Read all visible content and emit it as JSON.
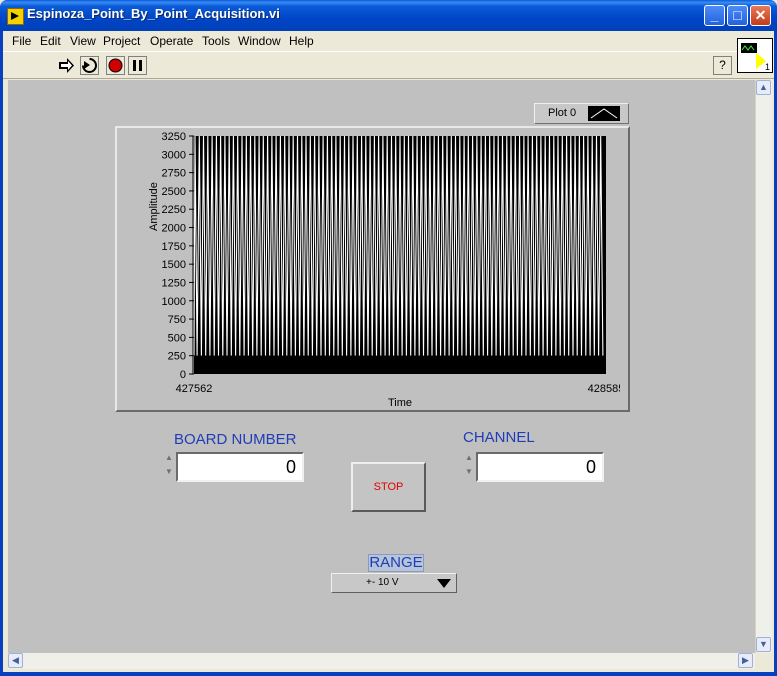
{
  "window": {
    "title": "Espinoza_Point_By_Point_Acquisition.vi"
  },
  "menu": [
    "File",
    "Edit",
    "View",
    "Project",
    "Operate",
    "Tools",
    "Window",
    "Help"
  ],
  "help_icon": "?",
  "vi_icon_number": "1",
  "graph": {
    "legend": "Plot 0",
    "ylabel": "Amplitude",
    "xlabel": "Time",
    "yticks": [
      "3250",
      "3000",
      "2750",
      "2500",
      "2250",
      "2000",
      "1750",
      "1500",
      "1250",
      "1000",
      "750",
      "500",
      "250",
      "0"
    ],
    "xstart": "427562",
    "xend": "428585"
  },
  "chart_data": {
    "type": "line",
    "title": "",
    "xlabel": "Time",
    "ylabel": "Amplitude",
    "xlim": [
      427562,
      428585
    ],
    "ylim": [
      0,
      3250
    ],
    "series": [
      {
        "name": "Plot 0",
        "x": [
          427562,
          428585
        ],
        "y_min": 250,
        "y_max": 3250
      }
    ],
    "grid": false,
    "legend": "top-right"
  },
  "board": {
    "label": "BOARD NUMBER",
    "value": "0"
  },
  "channel": {
    "label": "CHANNEL",
    "value": "0"
  },
  "stop": {
    "label": "STOP"
  },
  "range": {
    "label": "RANGE",
    "value": "+- 10 V"
  },
  "colors": {
    "label_blue": "#1f3db8",
    "stop_red": "#e00000",
    "plot_bg": "#000000",
    "plot_line": "#ffffff"
  }
}
